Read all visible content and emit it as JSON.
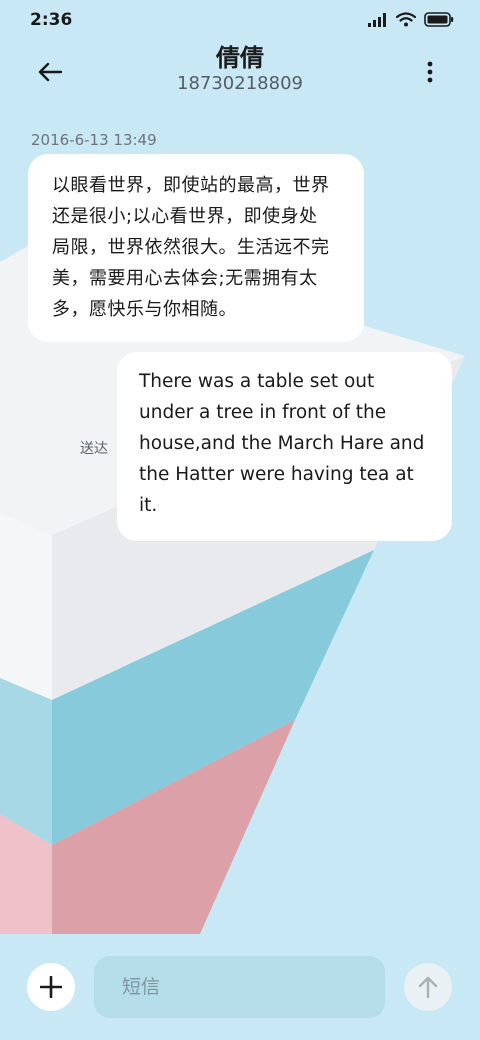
{
  "status_bar": {
    "time": "2:36",
    "icons": [
      "signal-icon",
      "wifi-icon",
      "battery-icon"
    ]
  },
  "header": {
    "contact_name": "倩倩",
    "contact_number": "18730218809",
    "back_icon": "back-arrow-icon",
    "more_icon": "more-vertical-icon"
  },
  "conversation": {
    "timestamp": "2016-6-13 13:49",
    "messages": [
      {
        "direction": "incoming",
        "lines": [
          "以眼看世界，即使站的最高，世界",
          "还是很小;以心看世界，即使身处",
          "局限，世界依然很大。生活远不完",
          "美，需要用心去体会;无需拥有太",
          "多，愿快乐与你相随。"
        ]
      },
      {
        "direction": "outgoing",
        "status": "送达",
        "lines": [
          "There was a table set out",
          "under a tree in front of the",
          "house,and the March Hare and",
          "the Hatter were having tea at",
          "it."
        ]
      }
    ]
  },
  "composer": {
    "attach_icon": "plus-icon",
    "placeholder": "短信",
    "value": "",
    "send_icon": "arrow-up-icon"
  },
  "colors": {
    "background": "#c9e8f5",
    "bubble": "#ffffff",
    "input_fill": "#b4dde9",
    "send_button": "#e9f1f4",
    "art_teal": "#86cadb",
    "art_pink": "#dca1a8"
  }
}
